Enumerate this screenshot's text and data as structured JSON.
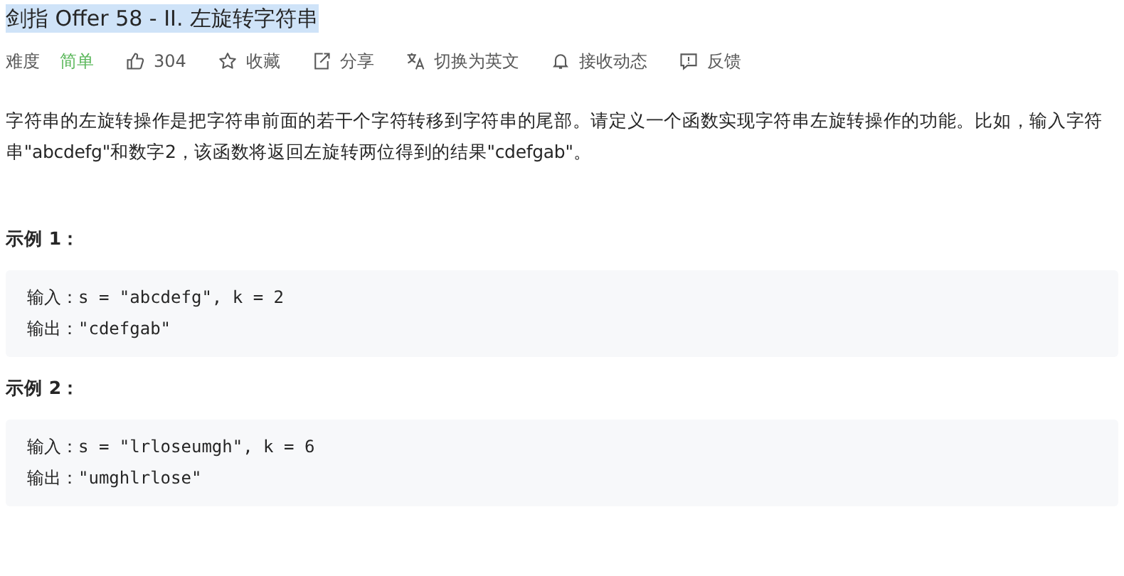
{
  "title": {
    "text": "剑指 Offer 58 - II. 左旋转字符串",
    "highlighted": true
  },
  "meta": {
    "difficulty_label": "难度",
    "difficulty": "简单",
    "actions": [
      {
        "kind": "like",
        "label": "304"
      },
      {
        "kind": "star",
        "label": "收藏"
      },
      {
        "kind": "share",
        "label": "分享"
      },
      {
        "kind": "translate",
        "label": "切换为英文"
      },
      {
        "kind": "bell",
        "label": "接收动态"
      },
      {
        "kind": "feedback",
        "label": "反馈"
      }
    ]
  },
  "description": "字符串的左旋转操作是把字符串前面的若干个字符转移到字符串的尾部。请定义一个函数实现字符串左旋转操作的功能。比如，输入字符串\"abcdefg\"和数字2，该函数将返回左旋转两位得到的结果\"cdefgab\"。",
  "examples": [
    {
      "heading": "示例 1：",
      "lines": [
        "输入：s = \"abcdefg\", k = 2",
        "输出：\"cdefgab\""
      ]
    },
    {
      "heading": "示例 2：",
      "lines": [
        "输入：s = \"lrloseumgh\", k = 6",
        "输出：\"umghlrlose\""
      ]
    }
  ]
}
